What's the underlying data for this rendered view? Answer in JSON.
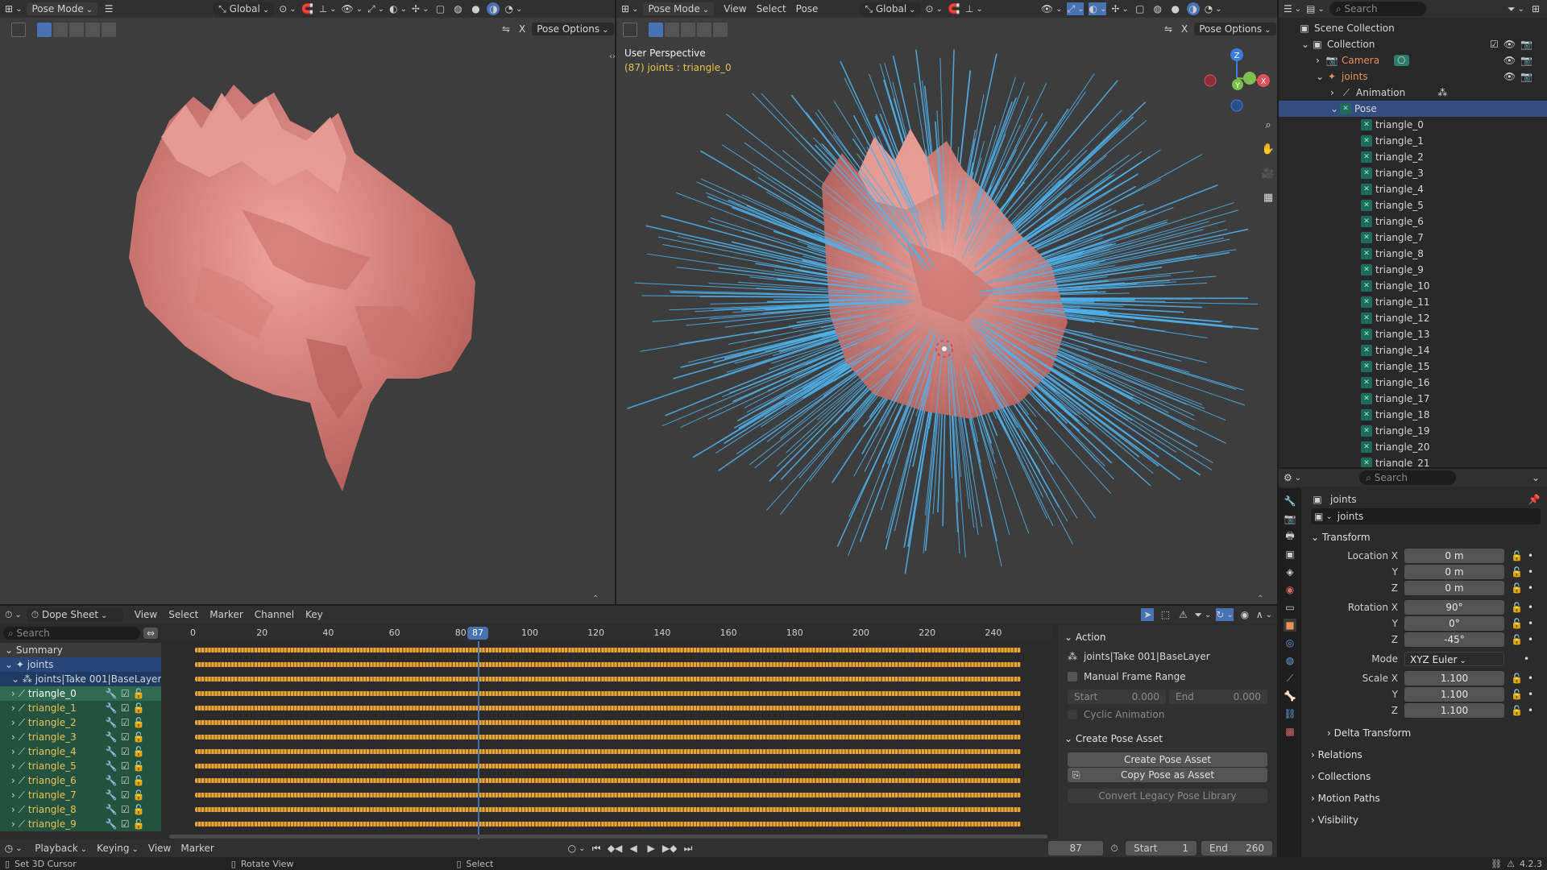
{
  "left_viewport": {
    "mode": "Pose Mode",
    "orientation": "Global",
    "pose_options": "Pose Options",
    "x_label": "X"
  },
  "right_viewport": {
    "mode": "Pose Mode",
    "menus": [
      "View",
      "Select",
      "Pose"
    ],
    "orientation": "Global",
    "pose_options": "Pose Options",
    "x_label": "X",
    "perspective_label": "User Perspective",
    "active_info": "(87) joints : triangle_0",
    "gizmo": {
      "x": "X",
      "y": "Y",
      "z": "Z"
    }
  },
  "outliner": {
    "search_placeholder": "Search",
    "scene_collection": "Scene Collection",
    "collection": "Collection",
    "camera": "Camera",
    "armature": "joints",
    "animation": "Animation",
    "pose": "Pose",
    "bones": [
      "triangle_0",
      "triangle_1",
      "triangle_2",
      "triangle_3",
      "triangle_4",
      "triangle_5",
      "triangle_6",
      "triangle_7",
      "triangle_8",
      "triangle_9",
      "triangle_10",
      "triangle_11",
      "triangle_12",
      "triangle_13",
      "triangle_14",
      "triangle_15",
      "triangle_16",
      "triangle_17",
      "triangle_18",
      "triangle_19",
      "triangle_20",
      "triangle_21"
    ]
  },
  "properties": {
    "search_placeholder": "Search",
    "object_name": "joints",
    "datablock": "joints",
    "transform_title": "Transform",
    "location_label": "Location X",
    "location": [
      "0 m",
      "0 m",
      "0 m"
    ],
    "rotation_label": "Rotation X",
    "rotation": [
      "90°",
      "0°",
      "-45°"
    ],
    "mode_label": "Mode",
    "mode_value": "XYZ Euler",
    "scale_label": "Scale X",
    "scale": [
      "1.100",
      "1.100",
      "1.100"
    ],
    "axis_y": "Y",
    "axis_z": "Z",
    "delta_transform": "Delta Transform",
    "relations": "Relations",
    "collections": "Collections",
    "motion_paths": "Motion Paths",
    "visibility": "Visibility"
  },
  "dopesheet": {
    "editor": "Dope Sheet",
    "menus": [
      "View",
      "Select",
      "Marker",
      "Channel",
      "Key"
    ],
    "search_placeholder": "Search",
    "ticks": [
      "0",
      "20",
      "40",
      "60",
      "80",
      "100",
      "120",
      "140",
      "160",
      "180",
      "200",
      "220",
      "240"
    ],
    "current_frame": "87",
    "summary": "Summary",
    "object": "joints",
    "action_channel": "joints|Take 001|BaseLayer",
    "channels": [
      "triangle_0",
      "triangle_1",
      "triangle_2",
      "triangle_3",
      "triangle_4",
      "triangle_5",
      "triangle_6",
      "triangle_7",
      "triangle_8",
      "triangle_9"
    ]
  },
  "action_panel": {
    "title": "Action",
    "action_name": "joints|Take 001|BaseLayer",
    "manual_frame_range": "Manual Frame Range",
    "start_label": "Start",
    "start_value": "0.000",
    "end_label": "End",
    "end_value": "0.000",
    "cyclic": "Cyclic Animation",
    "create_pose_asset_title": "Create Pose Asset",
    "create_pose_asset_btn": "Create Pose Asset",
    "copy_pose_btn": "Copy Pose as Asset",
    "convert_legacy_btn": "Convert Legacy Pose Library"
  },
  "timeline": {
    "menus": [
      "Playback",
      "Keying",
      "View",
      "Marker"
    ],
    "frame": "87",
    "start_label": "Start",
    "start": "1",
    "end_label": "End",
    "end": "260"
  },
  "statusbar": {
    "items": [
      "Set 3D Cursor",
      "Rotate View",
      "Select"
    ],
    "version": "4.2.3"
  },
  "colors": {
    "accent": "#4772b3",
    "bone_lines": "#4fb3ef",
    "mesh": "#e0918a",
    "keyframe": "#e8a23a"
  }
}
